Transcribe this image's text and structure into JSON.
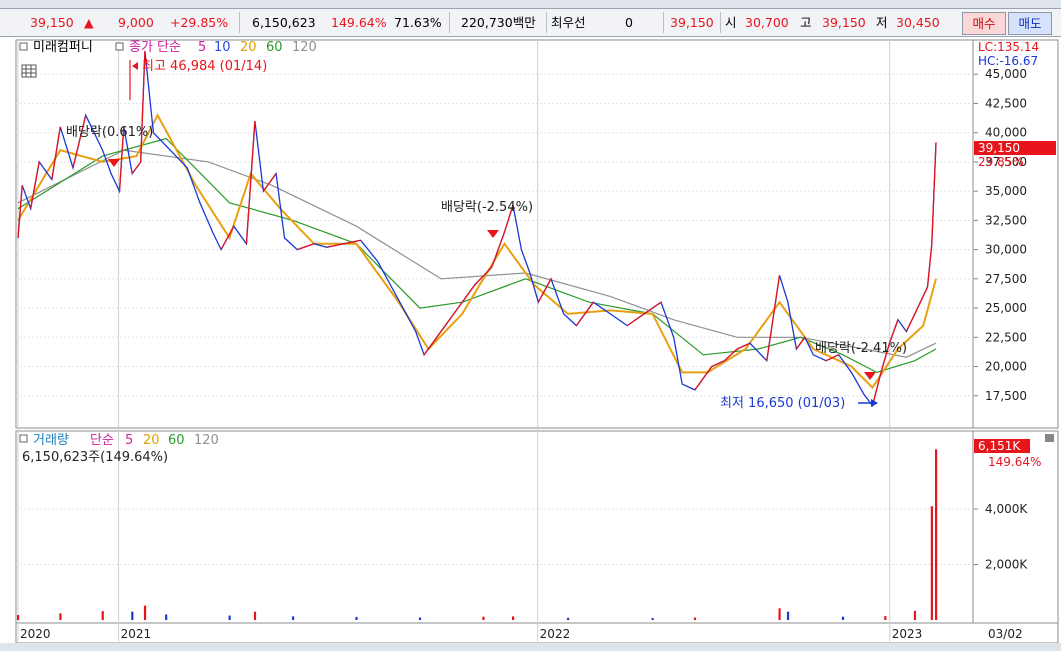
{
  "quote": {
    "price": "39,150",
    "change": "9,000",
    "change_pct": "+29.85%",
    "volume": "6,150,623",
    "volume_ratio": "149.64%",
    "turnover": "71.63%",
    "amount": "220,730백만",
    "preferred_label": "최우선",
    "preferred_value": "0",
    "ask_price": "39,150",
    "open_label": "시",
    "open": "30,700",
    "high_label": "고",
    "high": "39,150",
    "low_label": "저",
    "low": "30,450",
    "buy_label": "매수",
    "sell_label": "매도"
  },
  "price_panel": {
    "stock_name": "미래컴퍼니",
    "ma_label": "종가 단순",
    "ma_periods": [
      "5",
      "10",
      "20",
      "60",
      "120"
    ],
    "lc_label": "LC:135.14",
    "hc_label": "HC:-16.67",
    "high_annotation": "최고 46,984 (01/14)",
    "low_annotation": "최저 16,650 (01/03)",
    "dividend_annotations": [
      "배당락(0.61%)",
      "배당락(-2.54%)",
      "배당락(-2.41%)"
    ],
    "current_price_tag": "39,150",
    "current_change_tag": "29.85%"
  },
  "volume_panel": {
    "label": "거래량",
    "ma_label": "단순",
    "ma_periods": [
      "5",
      "20",
      "60",
      "120"
    ],
    "summary": "6,150,623주(149.64%)",
    "current_tag": "6,151K",
    "current_pct_tag": "149.64%"
  },
  "colors": {
    "up": "#e8141c",
    "down": "#1838d8",
    "ma5": "#e8a010",
    "ma20": "#2a9a2a",
    "ma60": "#909090",
    "ma120": "#909090",
    "tag_bg": "#e8141c"
  },
  "chart_data": [
    {
      "type": "line",
      "title": "",
      "x": [
        "2020",
        "2021",
        "2022",
        "2023",
        "03/02"
      ],
      "xlabel": "",
      "ylabel": "",
      "ylim": [
        15000,
        47500
      ],
      "yticks": [
        "17,500",
        "20,000",
        "22,500",
        "25,000",
        "27,500",
        "30,000",
        "32,500",
        "35,000",
        "37,500",
        "40,000",
        "42,500",
        "45,000"
      ],
      "series": [
        {
          "name": "종가",
          "values": [
            [
              0.0,
              31000
            ],
            [
              0.01,
              35500
            ],
            [
              0.03,
              33500
            ],
            [
              0.05,
              37500
            ],
            [
              0.08,
              36000
            ],
            [
              0.1,
              40500
            ],
            [
              0.13,
              37000
            ],
            [
              0.16,
              41500
            ],
            [
              0.2,
              38500
            ],
            [
              0.22,
              36500
            ],
            [
              0.24,
              35000
            ],
            [
              0.25,
              40500
            ],
            [
              0.27,
              36500
            ],
            [
              0.29,
              37500
            ],
            [
              0.3,
              46984
            ],
            [
              0.32,
              40000
            ],
            [
              0.36,
              38500
            ],
            [
              0.4,
              37000
            ],
            [
              0.43,
              34000
            ],
            [
              0.46,
              31500
            ],
            [
              0.48,
              30000
            ],
            [
              0.51,
              32000
            ],
            [
              0.54,
              30500
            ],
            [
              0.56,
              41000
            ],
            [
              0.58,
              35000
            ],
            [
              0.61,
              36500
            ],
            [
              0.63,
              31000
            ],
            [
              0.66,
              30000
            ],
            [
              0.7,
              30500
            ],
            [
              0.73,
              30200
            ],
            [
              0.77,
              30500
            ],
            [
              0.81,
              30800
            ],
            [
              0.85,
              29000
            ],
            [
              0.88,
              27000
            ],
            [
              0.91,
              25000
            ],
            [
              0.94,
              23000
            ],
            [
              0.96,
              21000
            ],
            [
              0.99,
              22500
            ],
            [
              1.02,
              24000
            ],
            [
              1.05,
              25500
            ],
            [
              1.08,
              27000
            ],
            [
              1.12,
              28500
            ],
            [
              1.15,
              31500
            ],
            [
              1.17,
              33800
            ],
            [
              1.19,
              30000
            ],
            [
              1.21,
              28000
            ],
            [
              1.23,
              25500
            ],
            [
              1.26,
              27500
            ],
            [
              1.29,
              24500
            ],
            [
              1.32,
              23500
            ],
            [
              1.36,
              25500
            ],
            [
              1.4,
              24500
            ],
            [
              1.44,
              23500
            ],
            [
              1.48,
              24500
            ],
            [
              1.52,
              25500
            ],
            [
              1.55,
              22500
            ],
            [
              1.57,
              18500
            ],
            [
              1.6,
              18000
            ],
            [
              1.64,
              20000
            ],
            [
              1.67,
              20500
            ],
            [
              1.7,
              21500
            ],
            [
              1.73,
              22000
            ],
            [
              1.77,
              20500
            ],
            [
              1.8,
              27800
            ],
            [
              1.82,
              25500
            ],
            [
              1.84,
              21500
            ],
            [
              1.86,
              22500
            ],
            [
              1.88,
              21000
            ],
            [
              1.91,
              20500
            ],
            [
              1.94,
              21000
            ],
            [
              1.97,
              19500
            ],
            [
              2.0,
              17600
            ],
            [
              2.02,
              16650
            ],
            [
              2.04,
              19500
            ],
            [
              2.06,
              22000
            ],
            [
              2.08,
              24000
            ],
            [
              2.1,
              23000
            ],
            [
              2.12,
              24500
            ],
            [
              2.15,
              26800
            ],
            [
              2.16,
              30450
            ],
            [
              2.17,
              39150
            ]
          ]
        },
        {
          "name": "5",
          "values": [
            [
              0.0,
              32500
            ],
            [
              0.1,
              38500
            ],
            [
              0.2,
              37500
            ],
            [
              0.28,
              38000
            ],
            [
              0.33,
              41500
            ],
            [
              0.42,
              35500
            ],
            [
              0.5,
              31000
            ],
            [
              0.55,
              36500
            ],
            [
              0.62,
              33500
            ],
            [
              0.7,
              30500
            ],
            [
              0.8,
              30500
            ],
            [
              0.9,
              25500
            ],
            [
              0.97,
              21500
            ],
            [
              1.05,
              24500
            ],
            [
              1.15,
              30500
            ],
            [
              1.22,
              27000
            ],
            [
              1.3,
              24500
            ],
            [
              1.4,
              24800
            ],
            [
              1.5,
              24500
            ],
            [
              1.57,
              19500
            ],
            [
              1.63,
              19500
            ],
            [
              1.72,
              21500
            ],
            [
              1.8,
              25500
            ],
            [
              1.88,
              21500
            ],
            [
              1.97,
              20000
            ],
            [
              2.02,
              18200
            ],
            [
              2.08,
              21500
            ],
            [
              2.14,
              23500
            ],
            [
              2.17,
              27500
            ]
          ]
        },
        {
          "name": "20",
          "values": [
            [
              0.0,
              33500
            ],
            [
              0.2,
              38000
            ],
            [
              0.35,
              39500
            ],
            [
              0.5,
              34000
            ],
            [
              0.65,
              32500
            ],
            [
              0.8,
              30500
            ],
            [
              0.95,
              25000
            ],
            [
              1.05,
              25500
            ],
            [
              1.2,
              27500
            ],
            [
              1.35,
              25500
            ],
            [
              1.5,
              24500
            ],
            [
              1.62,
              21000
            ],
            [
              1.75,
              21500
            ],
            [
              1.85,
              22500
            ],
            [
              1.95,
              21000
            ],
            [
              2.03,
              19500
            ],
            [
              2.12,
              20500
            ],
            [
              2.17,
              21500
            ]
          ]
        },
        {
          "name": "60",
          "values": [
            [
              0.0,
              34000
            ],
            [
              0.25,
              38500
            ],
            [
              0.45,
              37500
            ],
            [
              0.6,
              35500
            ],
            [
              0.8,
              32000
            ],
            [
              1.0,
              27500
            ],
            [
              1.2,
              28000
            ],
            [
              1.4,
              26000
            ],
            [
              1.55,
              24000
            ],
            [
              1.7,
              22500
            ],
            [
              1.85,
              22500
            ],
            [
              2.0,
              21500
            ],
            [
              2.1,
              20800
            ],
            [
              2.17,
              22000
            ]
          ]
        }
      ]
    },
    {
      "type": "bar",
      "title": "",
      "ylabel": "",
      "ylim": [
        0,
        6200
      ],
      "yticks": [
        "2,000K",
        "4,000K"
      ],
      "note_units": "K shares",
      "values": [
        [
          0.0,
          180
        ],
        [
          0.1,
          240
        ],
        [
          0.2,
          320
        ],
        [
          0.27,
          300
        ],
        [
          0.3,
          520
        ],
        [
          0.35,
          200
        ],
        [
          0.5,
          160
        ],
        [
          0.56,
          300
        ],
        [
          0.65,
          130
        ],
        [
          0.8,
          110
        ],
        [
          0.95,
          90
        ],
        [
          1.1,
          120
        ],
        [
          1.17,
          130
        ],
        [
          1.3,
          80
        ],
        [
          1.5,
          70
        ],
        [
          1.6,
          90
        ],
        [
          1.8,
          420
        ],
        [
          1.82,
          300
        ],
        [
          1.95,
          120
        ],
        [
          2.05,
          140
        ],
        [
          2.12,
          330
        ],
        [
          2.16,
          4100
        ],
        [
          2.17,
          6151
        ]
      ]
    }
  ]
}
